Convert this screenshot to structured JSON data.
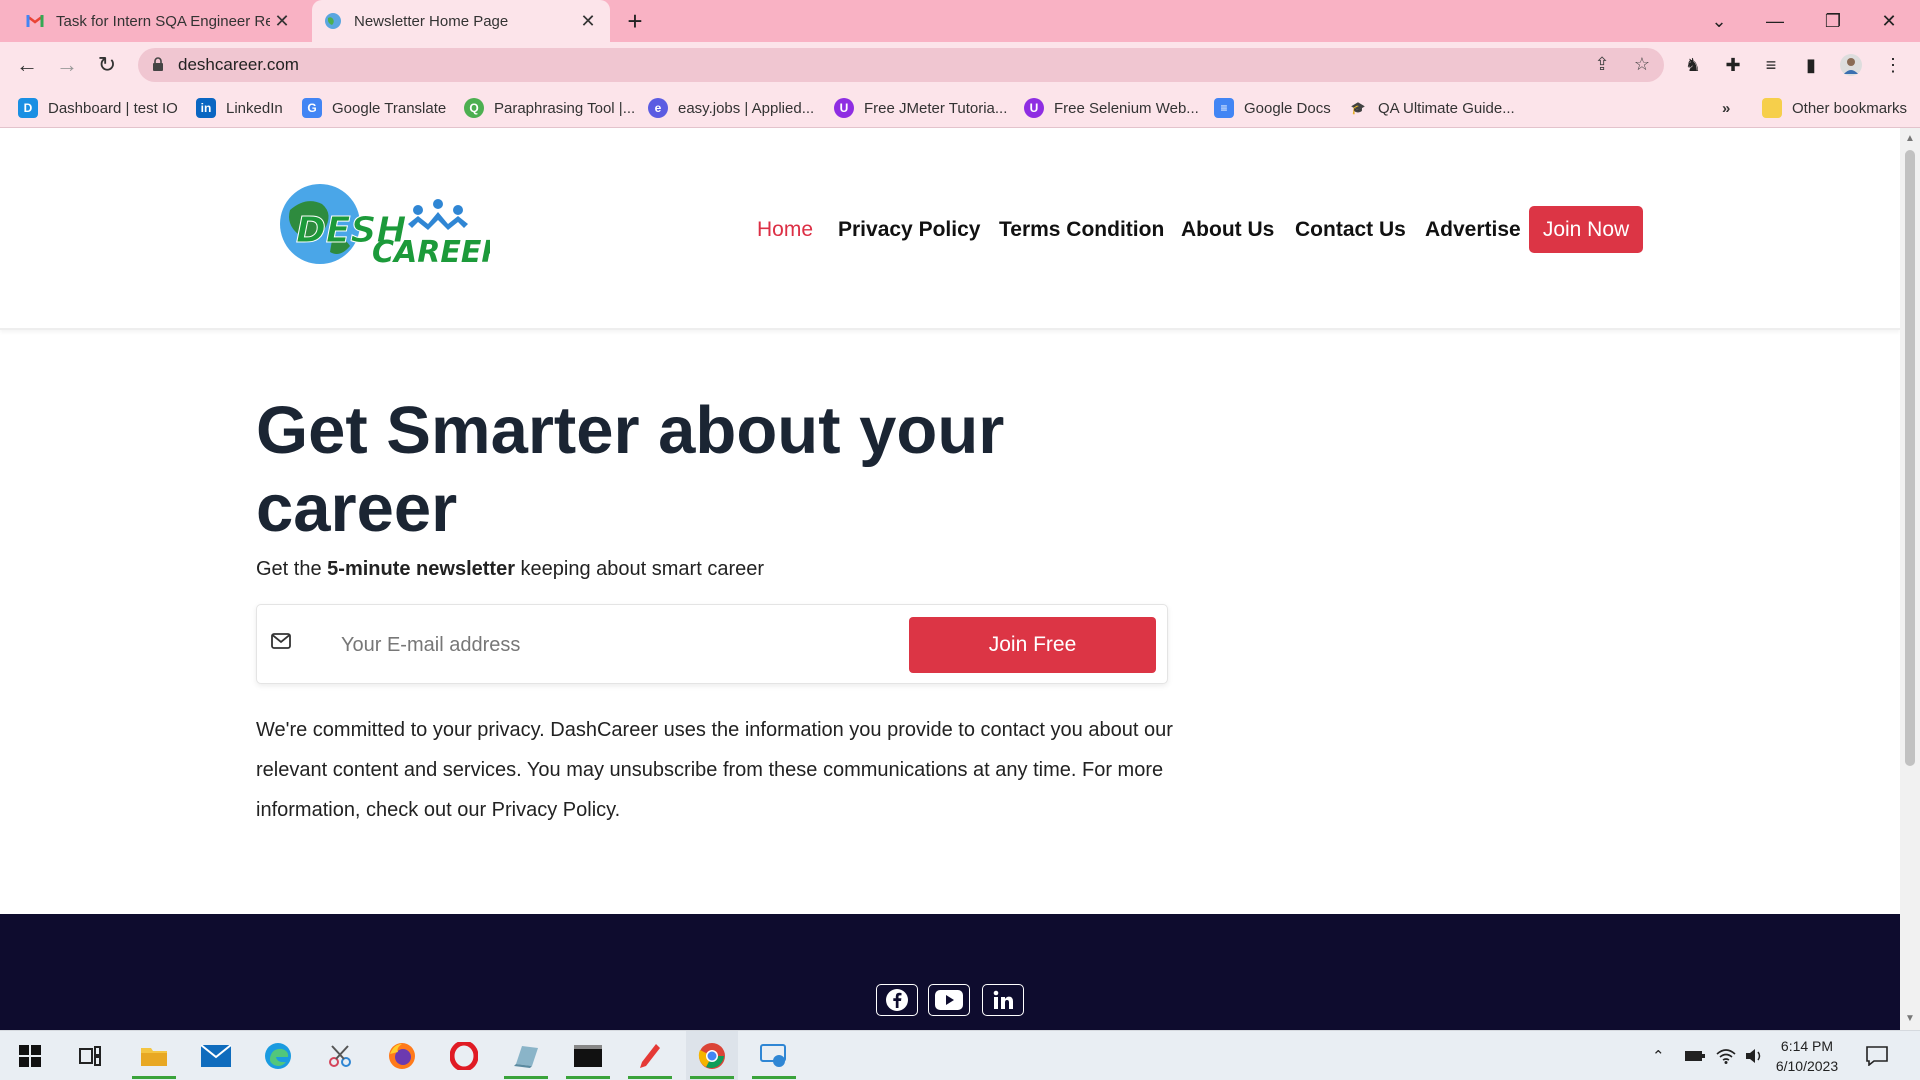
{
  "browser": {
    "tabs": [
      {
        "title": "Task for Intern SQA Engineer Rec",
        "icon": "gmail-icon",
        "active": false
      },
      {
        "title": "Newsletter Home Page",
        "icon": "globe-icon",
        "active": true
      }
    ],
    "url": "deshcareer.com",
    "bookmarks": [
      {
        "label": "Dashboard | test IO",
        "icon": "testio-icon",
        "color": "#1a8fe3"
      },
      {
        "label": "LinkedIn",
        "icon": "linkedin-icon",
        "color": "#0a66c2"
      },
      {
        "label": "Google Translate",
        "icon": "translate-icon",
        "color": "#4285f4"
      },
      {
        "label": "Paraphrasing Tool |...",
        "icon": "quillbot-icon",
        "color": "#4caf50"
      },
      {
        "label": "easy.jobs | Applied...",
        "icon": "easyjobs-icon",
        "color": "#5b5ce2"
      },
      {
        "label": "Free JMeter Tutoria...",
        "icon": "udemy-icon",
        "color": "#8e2de2"
      },
      {
        "label": "Free Selenium Web...",
        "icon": "udemy-icon",
        "color": "#8e2de2"
      },
      {
        "label": "Google Docs",
        "icon": "docs-icon",
        "color": "#4285f4"
      },
      {
        "label": "QA Ultimate Guide...",
        "icon": "hat-icon",
        "color": "#333333"
      }
    ],
    "more_bookmarks": "»",
    "other_bookmarks": "Other bookmarks"
  },
  "site": {
    "logo_top": "DESH",
    "logo_bottom": "CAREER",
    "nav": [
      "Home",
      "Privacy Policy",
      "Terms Condition",
      "About Us",
      "Contact Us",
      "Advertise"
    ],
    "join_now": "Join Now",
    "hero_title": "Get Smarter about your career",
    "hero_sub_pre": "Get the ",
    "hero_sub_bold": "5-minute newsletter",
    "hero_sub_post": " keeping about smart career",
    "email_placeholder": "Your E-mail address",
    "join_free": "Join Free",
    "privacy_text": "We're committed to your privacy. DashCareer uses the information you provide to contact you about our relevant content and services. You may unsubscribe from these communications at any time. For more information, check out our Privacy Policy.",
    "social": [
      "facebook-icon",
      "youtube-icon",
      "linkedin-icon"
    ],
    "accent_color": "#dc3545",
    "footer_color": "#0e0c2e"
  },
  "taskbar": {
    "time": "6:14 PM",
    "date": "6/10/2023"
  }
}
